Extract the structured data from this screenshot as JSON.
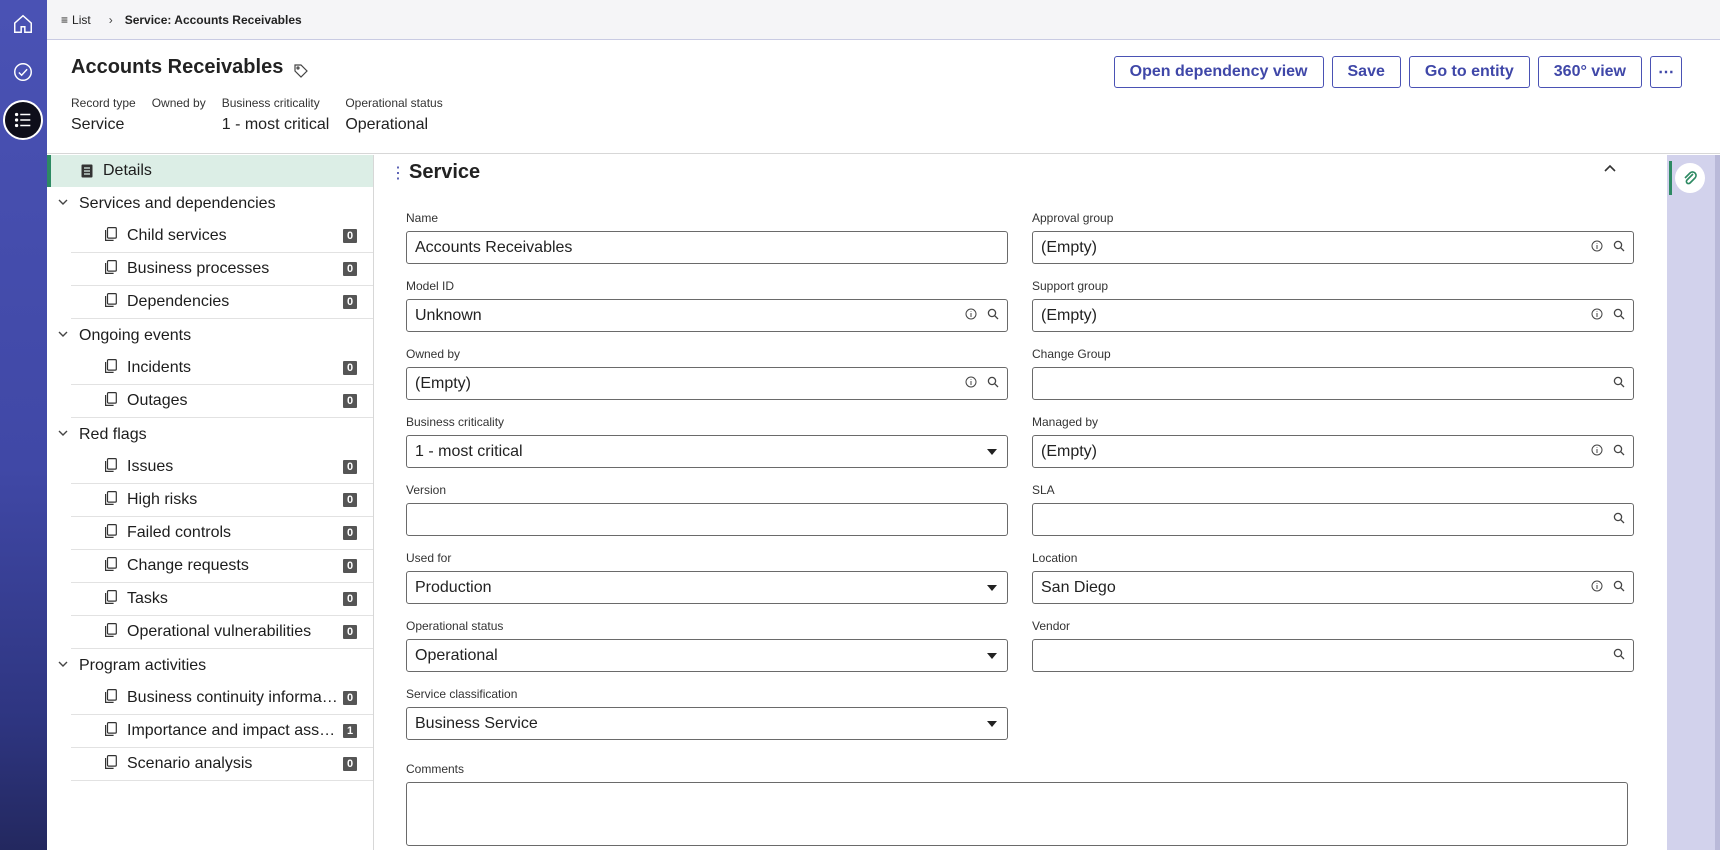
{
  "rail": {
    "items": [
      {
        "icon": "home-icon"
      },
      {
        "icon": "check-circle-icon"
      },
      {
        "icon": "list-icon",
        "active": true
      }
    ]
  },
  "topbar": {
    "list_label": "List",
    "breadcrumb": "Service: Accounts Receivables"
  },
  "header": {
    "title": "Accounts Receivables",
    "meta": [
      {
        "label": "Record type",
        "value": "Service"
      },
      {
        "label": "Owned by",
        "value": ""
      },
      {
        "label": "Business criticality",
        "value": "1 - most critical"
      },
      {
        "label": "Operational status",
        "value": "Operational"
      }
    ],
    "actions": {
      "dependency": "Open dependency view",
      "save": "Save",
      "entity": "Go to entity",
      "view360": "360° view",
      "more": "⋯"
    }
  },
  "sidebar": {
    "details": "Details",
    "groups": [
      {
        "label": "Services and dependencies",
        "items": [
          {
            "label": "Child services",
            "count": "0"
          },
          {
            "label": "Business processes",
            "count": "0"
          },
          {
            "label": "Dependencies",
            "count": "0"
          }
        ]
      },
      {
        "label": "Ongoing events",
        "items": [
          {
            "label": "Incidents",
            "count": "0"
          },
          {
            "label": "Outages",
            "count": "0"
          }
        ]
      },
      {
        "label": "Red flags",
        "items": [
          {
            "label": "Issues",
            "count": "0"
          },
          {
            "label": "High risks",
            "count": "0"
          },
          {
            "label": "Failed controls",
            "count": "0"
          },
          {
            "label": "Change requests",
            "count": "0"
          },
          {
            "label": "Tasks",
            "count": "0"
          },
          {
            "label": "Operational vulnerabilities",
            "count": "0"
          }
        ]
      },
      {
        "label": "Program activities",
        "items": [
          {
            "label": "Business continuity informat...",
            "count": "0"
          },
          {
            "label": "Importance and impact asse...",
            "count": "1"
          },
          {
            "label": "Scenario analysis",
            "count": "0"
          }
        ]
      }
    ]
  },
  "section": {
    "title": "Service",
    "left_fields": [
      {
        "label": "Name",
        "value": "Accounts Receivables",
        "kind": "text"
      },
      {
        "label": "Model ID",
        "value": "Unknown",
        "kind": "lookup-info"
      },
      {
        "label": "Owned by",
        "value": "(Empty)",
        "kind": "lookup-info"
      },
      {
        "label": "Business criticality",
        "value": "1 - most critical",
        "kind": "select"
      },
      {
        "label": "Version",
        "value": "",
        "kind": "text"
      },
      {
        "label": "Used for",
        "value": "Production",
        "kind": "select"
      },
      {
        "label": "Operational status",
        "value": "Operational",
        "kind": "select"
      },
      {
        "label": "Service classification",
        "value": "Business Service",
        "kind": "select"
      }
    ],
    "right_fields": [
      {
        "label": "Approval group",
        "value": "(Empty)",
        "kind": "lookup-info"
      },
      {
        "label": "Support group",
        "value": "(Empty)",
        "kind": "lookup-info"
      },
      {
        "label": "Change Group",
        "value": "",
        "kind": "lookup"
      },
      {
        "label": "Managed by",
        "value": "(Empty)",
        "kind": "lookup-info"
      },
      {
        "label": "SLA",
        "value": "",
        "kind": "lookup"
      },
      {
        "label": "Location",
        "value": "San Diego",
        "kind": "lookup-info"
      },
      {
        "label": "Vendor",
        "value": "",
        "kind": "lookup"
      }
    ],
    "comments_label": "Comments"
  },
  "utility": {
    "icon": "paperclip-icon"
  },
  "colors": {
    "rail": "#4a52b4",
    "accent": "#3f47a8",
    "active_nav": "#dceee6",
    "active_bar": "#2d8a63",
    "utility": "#d2d2ec"
  }
}
